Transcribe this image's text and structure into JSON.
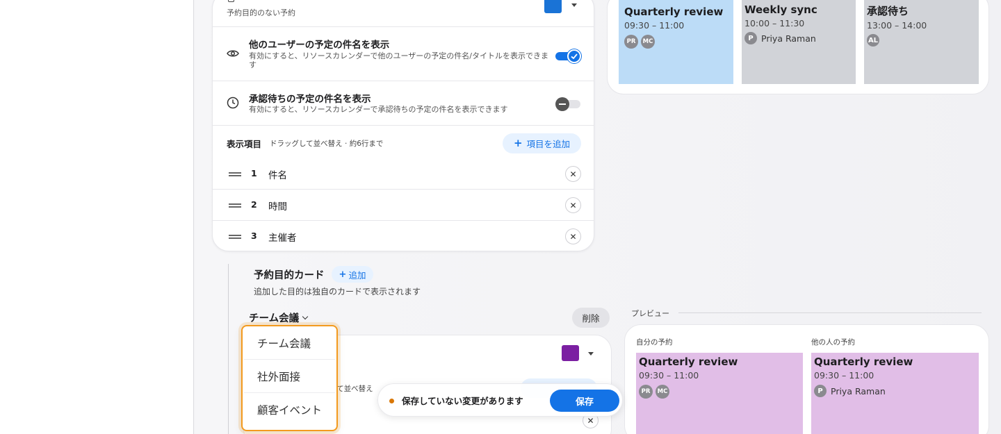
{
  "colors": {
    "accent": "#1473e6",
    "standard_swatch": "#1a73d6",
    "team_swatch": "#7b1fa2",
    "own_event_bg": "#bcdcf7",
    "other_event_bg": "#d1d3d8",
    "purpose_event_bg": "#e1bee7",
    "unsaved_dot": "#d97706",
    "dropdown_outline": "#f39a1e"
  },
  "top_row": {
    "hint": "予約目的のない予約",
    "icon": "document-icon"
  },
  "toggles": [
    {
      "icon": "eye-icon",
      "title": "他のユーザーの予定の件名を表示",
      "description": "有効にすると、リソースカレンダーで他のユーザーの予定の件名/タイトルを表示できます",
      "state": true
    },
    {
      "icon": "clock-icon",
      "title": "承認待ちの予定の件名を表示",
      "description": "有効にすると、リソースカレンダーで承認待ちの予定の件名を表示できます",
      "state": false
    }
  ],
  "display_items": {
    "heading": "表示項目",
    "subheading": "ドラッグして並べ替え · 約6行まで",
    "add_label": "項目を追加",
    "items": [
      {
        "num": "1",
        "label": "件名"
      },
      {
        "num": "2",
        "label": "時間"
      },
      {
        "num": "3",
        "label": "主催者"
      }
    ]
  },
  "top_preview": {
    "events": [
      {
        "title": "Quarterly review",
        "time": "09:30 – 11:00",
        "avatars": [
          "PR",
          "MC"
        ]
      },
      {
        "title": "Weekly sync",
        "time": "10:00 – 11:30",
        "avatar": "P",
        "name": "Priya Raman"
      },
      {
        "title": "承認待ち",
        "time": "13:00 – 14:00",
        "avatars": [
          "AL"
        ]
      }
    ]
  },
  "purpose_cards": {
    "title": "予約目的カード",
    "add_label": "追加",
    "description": "追加した目的は独自のカードで表示されます",
    "selected": "チーム会議",
    "delete_label": "削除",
    "partial_hint": "して並べ替え",
    "options": [
      "チーム会議",
      "社外面接",
      "顧客イベント"
    ]
  },
  "toast": {
    "message": "保存していない変更があります",
    "save_label": "保存"
  },
  "bottom_preview": {
    "label": "プレビュー",
    "own_label": "自分の予約",
    "others_label": "他の人の予約",
    "own_event": {
      "title": "Quarterly review",
      "time": "09:30 – 11:00",
      "avatars": [
        "PR",
        "MC"
      ]
    },
    "other_event": {
      "title": "Quarterly review",
      "time": "09:30 – 11:00",
      "avatar": "P",
      "name": "Priya Raman"
    }
  }
}
